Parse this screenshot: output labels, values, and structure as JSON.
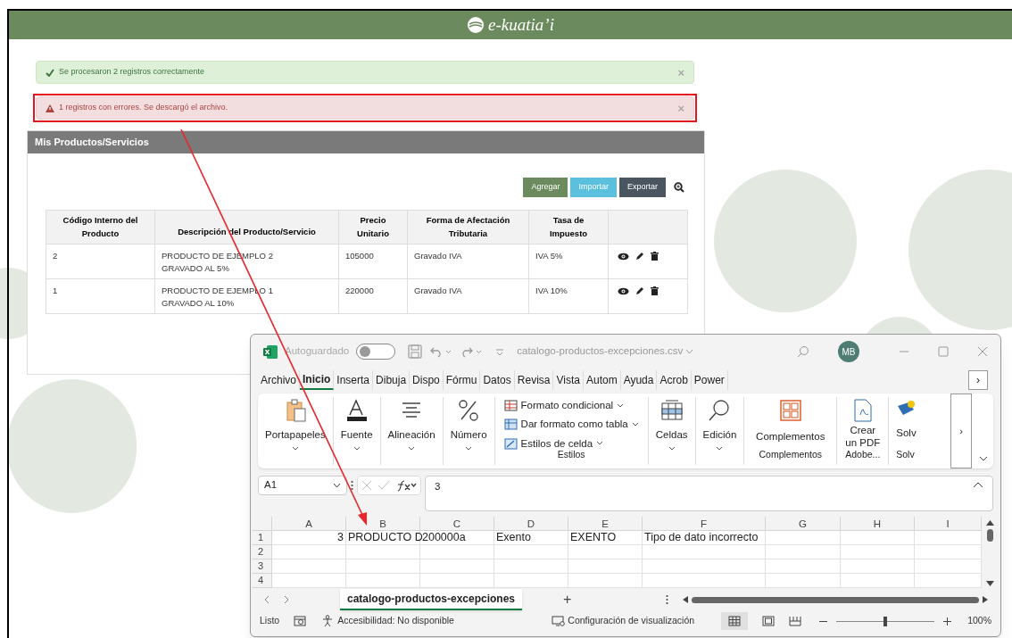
{
  "header": {
    "brand": "e-kuatia’i"
  },
  "alerts": [
    {
      "kind": "success",
      "text": "Se procesaron 2 registros correctamente",
      "close": "×",
      "highlighted": false
    },
    {
      "kind": "error",
      "text": "1 registros con errores. Se descargó el archivo.",
      "close": "×",
      "highlighted": true
    }
  ],
  "panel": {
    "title": "Mis Productos/Servicios",
    "buttons": [
      {
        "kind": "add",
        "label": "Agregar"
      },
      {
        "kind": "import",
        "label": "Importar"
      },
      {
        "kind": "export",
        "label": "Exportar"
      }
    ],
    "table": {
      "columns": [
        "Código Interno del Producto",
        "Descripción del Producto/Servicio",
        "Precio Unitario",
        "Forma de Afectación Tributaria",
        "Tasa de Impuesto"
      ],
      "rows": [
        {
          "cells": [
            "2",
            "PRODUCTO DE EJEMPLO 2 GRAVADO AL 5%",
            "105000",
            "Gravado IVA",
            "IVA 5%"
          ]
        },
        {
          "cells": [
            "1",
            "PRODUCTO DE EJEMPLO 1 GRAVADO AL 10%",
            "220000",
            "Gravado IVA",
            "IVA 10%"
          ]
        }
      ]
    }
  },
  "excel": {
    "autosave": {
      "label": "Autoguardado",
      "on": false
    },
    "title": "catalogo-productos-excepciones.csv",
    "avatar": "MB",
    "tabs": [
      {
        "label": "Archivo",
        "selected": false
      },
      {
        "label": "Inicio",
        "selected": true
      },
      {
        "label": "Inserta",
        "selected": false
      },
      {
        "label": "Dibuja",
        "selected": false
      },
      {
        "label": "Dispo",
        "selected": false
      },
      {
        "label": "Fórmu",
        "selected": false
      },
      {
        "label": "Datos",
        "selected": false
      },
      {
        "label": "Revisa",
        "selected": false
      },
      {
        "label": "Vista",
        "selected": false
      },
      {
        "label": "Autom",
        "selected": false
      },
      {
        "label": "Ayuda",
        "selected": false
      },
      {
        "label": "Acrob",
        "selected": false
      },
      {
        "label": "Power",
        "selected": false
      }
    ],
    "tabs_more": "›",
    "ribbon": [
      {
        "kind": "big",
        "label": "Portapapeles"
      },
      {
        "kind": "big",
        "label": "Fuente"
      },
      {
        "kind": "big",
        "label": "Alineación"
      },
      {
        "kind": "big",
        "label": "Número"
      },
      {
        "kind": "styles",
        "items": [
          "Formato condicional",
          "Dar formato como tabla",
          "Estilos de celda"
        ],
        "group": "Estilos"
      },
      {
        "kind": "big",
        "label": "Celdas"
      },
      {
        "kind": "big",
        "label": "Edición"
      },
      {
        "kind": "addins",
        "label": "Complementos",
        "group": "Complementos"
      },
      {
        "kind": "pdf",
        "label": "Crear un PDF",
        "group": "Adobe..."
      },
      {
        "kind": "solver",
        "label": "Solv",
        "group": "Solv"
      }
    ],
    "ribbon_more": "›",
    "name_box": "A1",
    "formula": "3",
    "columns": [
      "A",
      "B",
      "C",
      "D",
      "E",
      "F",
      "G",
      "H",
      "I"
    ],
    "rows": [
      {
        "header": "1",
        "cells": [
          "3",
          "PRODUCTO D",
          "200000a",
          "Exento",
          "EXENTO",
          "Tipo de dato incorrecto",
          "",
          "",
          ""
        ]
      },
      {
        "header": "2",
        "cells": []
      },
      {
        "header": "3",
        "cells": []
      },
      {
        "header": "4",
        "cells": []
      }
    ],
    "sheet_tab": "catalogo-productos-excepciones",
    "add_sheet": "+",
    "status": {
      "ready": "Listo",
      "accessibility": "Accesibilidad: No disponible",
      "display": "Configuración de visualización",
      "zoom": "100%",
      "zoom_slider": {
        "level": 0.5
      }
    }
  }
}
